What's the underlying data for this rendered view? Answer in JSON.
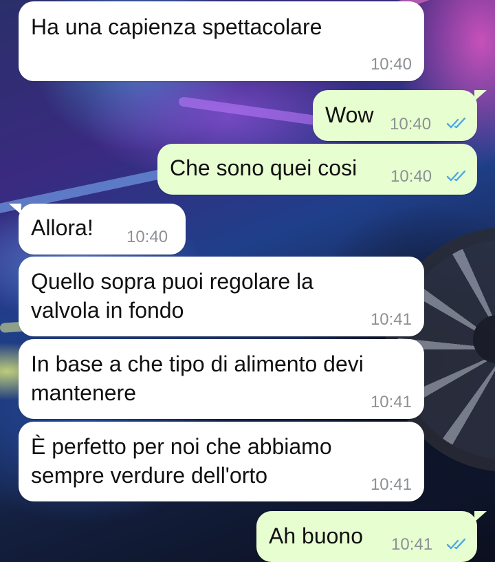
{
  "colors": {
    "incoming_bubble": "#ffffff",
    "outgoing_bubble": "#e7fed0",
    "timestamp": "#8c9195",
    "read_ticks": "#4fa8e6"
  },
  "messages": [
    {
      "direction": "incoming",
      "text_lines": [
        "Ha una capienza spettacolare"
      ],
      "time": "10:40"
    },
    {
      "direction": "outgoing",
      "text_lines": [
        "Wow"
      ],
      "time": "10:40",
      "status_icon": "double-check-read-icon"
    },
    {
      "direction": "outgoing",
      "text_lines": [
        "Che sono quei cosi"
      ],
      "time": "10:40",
      "status_icon": "double-check-read-icon"
    },
    {
      "direction": "incoming",
      "text_lines": [
        "Allora!"
      ],
      "time": "10:40"
    },
    {
      "direction": "incoming",
      "text_lines": [
        "Quello sopra puoi regolare la",
        "valvola in fondo"
      ],
      "time": "10:41"
    },
    {
      "direction": "incoming",
      "text_lines": [
        "In base a che tipo di alimento devi",
        "mantenere"
      ],
      "time": "10:41"
    },
    {
      "direction": "incoming",
      "text_lines": [
        "È perfetto per noi che abbiamo",
        "sempre verdure dell'orto"
      ],
      "time": "10:41"
    },
    {
      "direction": "outgoing",
      "text_lines": [
        "Ah buono"
      ],
      "time": "10:41",
      "status_icon": "double-check-read-icon"
    }
  ]
}
